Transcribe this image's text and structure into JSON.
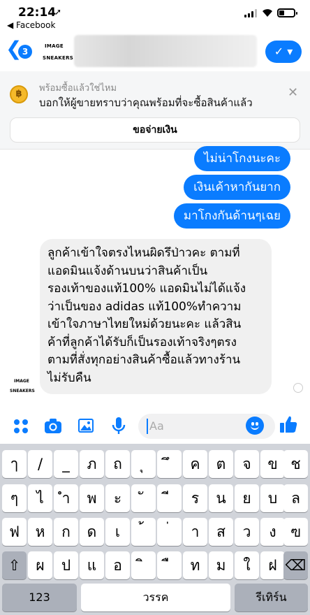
{
  "status_bar": {
    "time": "22:14",
    "location_arrow": "➚",
    "back_app": "◀ Facebook"
  },
  "header": {
    "back_icon": "❮",
    "unread_count": "3",
    "avatar_logo_line1": "IMAGE",
    "avatar_logo_line2": "SNEAKERS",
    "check_button": "✓ ▾"
  },
  "banner": {
    "coin_symbol": "฿",
    "title": "พร้อมซื้อแล้วใช่ไหม",
    "subtitle": "บอกให้ผู้ขายทราบว่าคุณพร้อมที่จะซื้อสินค้าแล้ว",
    "close_icon": "✕",
    "pay_button": "ขอจ่ายเงิน"
  },
  "messages": {
    "outgoing": [
      "ไม่น่าโกงนะคะ",
      "เงินเค้าหากันยาก",
      "มาโกงกันด้านๆเฉย"
    ],
    "incoming": {
      "lines": [
        "ลูกค้าเข้าใจตรงไหนผิดรึป่าวคะ ตามที่",
        "แอดมินแจ้งด้านบนว่าสินค้าเป็น",
        "รองเท้าของแท้100% แอดมินไม่ได้แจ้ง",
        "ว่าเป็นของ adidas แท้100%ทำความ",
        "เข้าใจภาษาไทยใหม่ด้วยนะคะ แล้วสิน",
        "ค้าที่ลูกค้าได้รับก็เป็นรองเท้าจริงๆตรง",
        "ตามที่สั่งทุกอย่างสินค้าซื้อแล้วทางร้าน",
        "ไม่รับคืน"
      ],
      "avatar_logo_line1": "IMAGE",
      "avatar_logo_line2": "SNEAKERS"
    }
  },
  "composer": {
    "placeholder": "Aa",
    "icons": [
      "grid-icon",
      "camera-icon",
      "photo-icon",
      "microphone-icon",
      "emoji-icon",
      "thumbs-up-icon"
    ],
    "accent_color": "#0a7cff"
  },
  "keyboard": {
    "row1": [
      "ๅ",
      "/",
      "_",
      "ภ",
      "ถ",
      "ุ",
      "ึ",
      "ค",
      "ต",
      "จ",
      "ข",
      "ช"
    ],
    "row2": [
      "ๆ",
      "ไ",
      "ำ",
      "พ",
      "ะ",
      "ั",
      "ี",
      "ร",
      "น",
      "ย",
      "บ",
      "ล"
    ],
    "row3": [
      "ฟ",
      "ห",
      "ก",
      "ด",
      "เ",
      "้",
      "่",
      "า",
      "ส",
      "ว",
      "ง",
      "ฃ"
    ],
    "row4": [
      "ผ",
      "ป",
      "แ",
      "อ",
      "ิ",
      "ื",
      "ท",
      "ม",
      "ใ",
      "ฝ"
    ],
    "shift": "⇧",
    "delete": "⌫",
    "numbers": "123",
    "space": "วรรค",
    "return": "รีเทิร์น"
  }
}
